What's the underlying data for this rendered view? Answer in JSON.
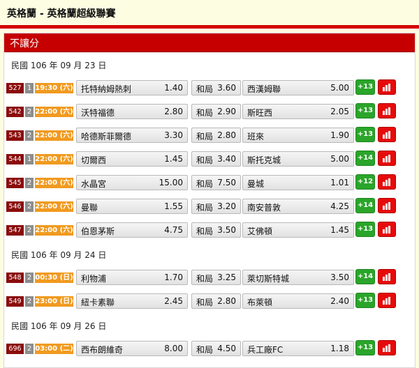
{
  "page_title": "英格蘭 - 英格蘭超級聯賽",
  "section_title": "不讓分",
  "draw_label": "和局",
  "days": [
    {
      "date": "民國 106 年 09 月 23 日",
      "matches": [
        {
          "id": "527",
          "level": "1",
          "time": "19:30 (六)",
          "home": "托特納姆熱刺",
          "home_odds": "1.40",
          "draw_odds": "3.60",
          "away": "西漢姆聯",
          "away_odds": "5.00",
          "more": "+13"
        },
        {
          "id": "542",
          "level": "2",
          "time": "22:00 (六)",
          "home": "沃特福德",
          "home_odds": "2.80",
          "draw_odds": "2.90",
          "away": "斯旺西",
          "away_odds": "2.05",
          "more": "+13"
        },
        {
          "id": "543",
          "level": "2",
          "time": "22:00 (六)",
          "home": "哈德斯菲爾德",
          "home_odds": "3.30",
          "draw_odds": "2.80",
          "away": "班來",
          "away_odds": "1.90",
          "more": "+13"
        },
        {
          "id": "544",
          "level": "1",
          "time": "22:00 (六)",
          "home": "切爾西",
          "home_odds": "1.45",
          "draw_odds": "3.40",
          "away": "斯托克城",
          "away_odds": "5.00",
          "more": "+14"
        },
        {
          "id": "545",
          "level": "2",
          "time": "22:00 (六)",
          "home": "水晶宮",
          "home_odds": "15.00",
          "draw_odds": "7.50",
          "away": "曼城",
          "away_odds": "1.01",
          "more": "+12"
        },
        {
          "id": "546",
          "level": "2",
          "time": "22:00 (六)",
          "home": "曼聯",
          "home_odds": "1.55",
          "draw_odds": "3.20",
          "away": "南安普敦",
          "away_odds": "4.25",
          "more": "+14"
        },
        {
          "id": "547",
          "level": "2",
          "time": "22:00 (六)",
          "home": "伯恩茅斯",
          "home_odds": "4.75",
          "draw_odds": "3.50",
          "away": "艾佛頓",
          "away_odds": "1.45",
          "more": "+13"
        }
      ]
    },
    {
      "date": "民國 106 年 09 月 24 日",
      "matches": [
        {
          "id": "548",
          "level": "2",
          "time": "00:30 (日)",
          "home": "利物浦",
          "home_odds": "1.70",
          "draw_odds": "3.25",
          "away": "萊切斯特城",
          "away_odds": "3.50",
          "more": "+14"
        },
        {
          "id": "549",
          "level": "2",
          "time": "23:00 (日)",
          "home": "紐卡素聯",
          "home_odds": "2.45",
          "draw_odds": "2.80",
          "away": "布萊頓",
          "away_odds": "2.40",
          "more": "+13"
        }
      ]
    },
    {
      "date": "民國 106 年 09 月 26 日",
      "matches": [
        {
          "id": "696",
          "level": "2",
          "time": "03:00 (二)",
          "home": "西布朗維奇",
          "home_odds": "8.00",
          "draw_odds": "4.50",
          "away": "兵工廠FC",
          "away_odds": "1.18",
          "more": "+13"
        }
      ]
    }
  ],
  "colors": {
    "header_red": "#c60000",
    "match_id": "#8b0c0c",
    "time_orange": "#f19a1f",
    "more_green": "#2aa52a",
    "stats_red": "#e60b0b"
  },
  "icons": {
    "stats": "bar-chart-icon"
  }
}
